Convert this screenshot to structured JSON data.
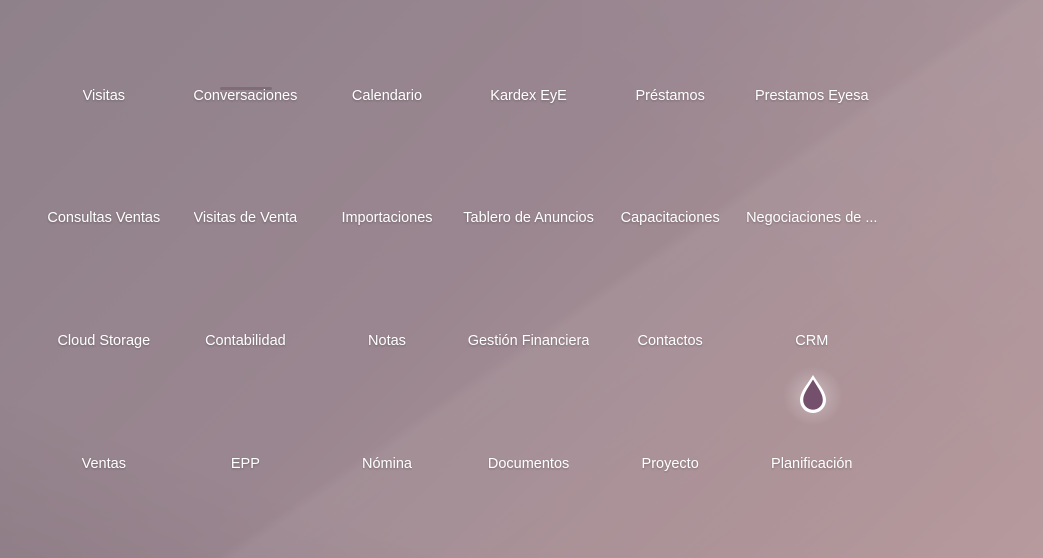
{
  "apps": [
    {
      "label": "Visitas"
    },
    {
      "label": "Conversaciones"
    },
    {
      "label": "Calendario"
    },
    {
      "label": "Kardex EyE"
    },
    {
      "label": "Préstamos"
    },
    {
      "label": "Prestamos Eyesa"
    },
    {
      "label": "Consultas Ventas"
    },
    {
      "label": "Visitas de Venta"
    },
    {
      "label": "Importaciones"
    },
    {
      "label": "Tablero de Anuncios"
    },
    {
      "label": "Capacitaciones"
    },
    {
      "label": "Negociaciones de ..."
    },
    {
      "label": "Cloud Storage"
    },
    {
      "label": "Contabilidad"
    },
    {
      "label": "Notas"
    },
    {
      "label": "Gestión Financiera"
    },
    {
      "label": "Contactos"
    },
    {
      "label": "CRM"
    },
    {
      "label": "Ventas"
    },
    {
      "label": "EPP"
    },
    {
      "label": "Nómina"
    },
    {
      "label": "Documentos"
    },
    {
      "label": "Proyecto"
    },
    {
      "label": "Planificación"
    }
  ],
  "cursor_icon": "drop-cursor-icon",
  "colors": {
    "background_start": "#8f818a",
    "background_end": "#b79a9d",
    "label": "#ffffff",
    "drop_fill": "#74506d"
  }
}
